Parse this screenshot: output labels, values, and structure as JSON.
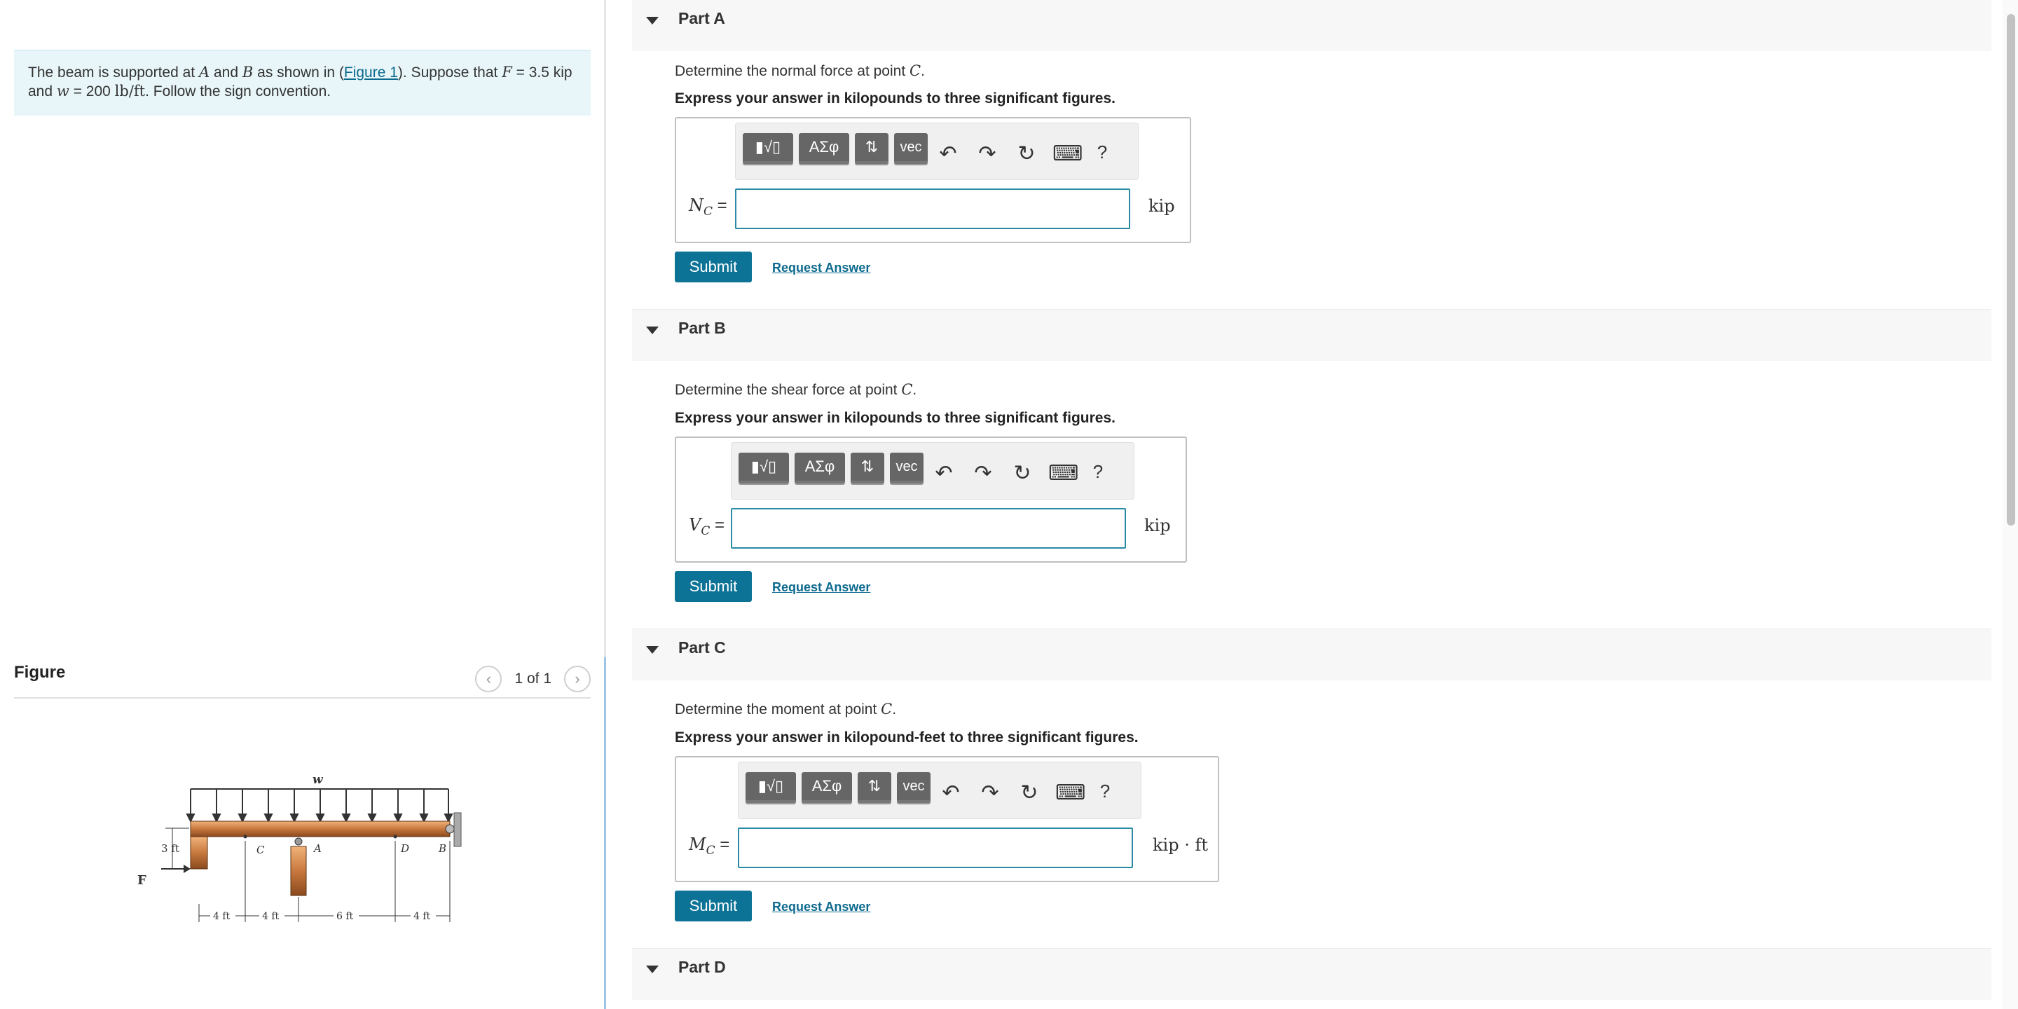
{
  "problem": {
    "t1": "The beam is supported at ",
    "A": "A",
    "t2": " and ",
    "B": "B",
    "t3": " as shown in (",
    "link": "Figure 1",
    "t4": "). Suppose that ",
    "F": "F",
    "t5": " = 3.5 kip",
    "t6": "and ",
    "w": "w",
    "t7": " = 200 ",
    "wunit": "lb/ft",
    "t8": ". Follow the sign convention."
  },
  "figure": {
    "title": "Figure",
    "pager": "1 of 1",
    "labels": {
      "w": "w",
      "h": "3 ft",
      "F": "F",
      "C": "C",
      "A": "A",
      "D": "D",
      "B": "B",
      "d1": "4 ft",
      "d2": "4 ft",
      "d3": "6 ft",
      "d4": "4 ft"
    }
  },
  "toolbar": {
    "templates": "▮√▯",
    "greek": "ΑΣφ",
    "arrows": "⇅",
    "vec": "vec",
    "undo": "↶",
    "redo": "↷",
    "reset": "↻",
    "keyboard": "⌨",
    "help": "?"
  },
  "parts": [
    {
      "title": "Part A",
      "q1": "Determine the normal force at point ",
      "q_var": "C",
      "q2": ".",
      "instr": "Express your answer in kilopounds to three significant figures.",
      "label_var": "N",
      "label_sub": "C",
      "eq": " =",
      "unit": "kip",
      "submit": "Submit",
      "request": "Request Answer"
    },
    {
      "title": "Part B",
      "q1": "Determine the shear force at point ",
      "q_var": "C",
      "q2": ".",
      "instr": "Express your answer in kilopounds to three significant figures.",
      "label_var": "V",
      "label_sub": "C",
      "eq": " =",
      "unit": "kip",
      "submit": "Submit",
      "request": "Request Answer"
    },
    {
      "title": "Part C",
      "q1": "Determine the moment at point ",
      "q_var": "C",
      "q2": ".",
      "instr": "Express your answer in kilopound-feet to three significant figures.",
      "label_var": "M",
      "label_sub": "C",
      "eq": " =",
      "unit": "kip · ft",
      "submit": "Submit",
      "request": "Request Answer"
    },
    {
      "title": "Part D"
    }
  ]
}
